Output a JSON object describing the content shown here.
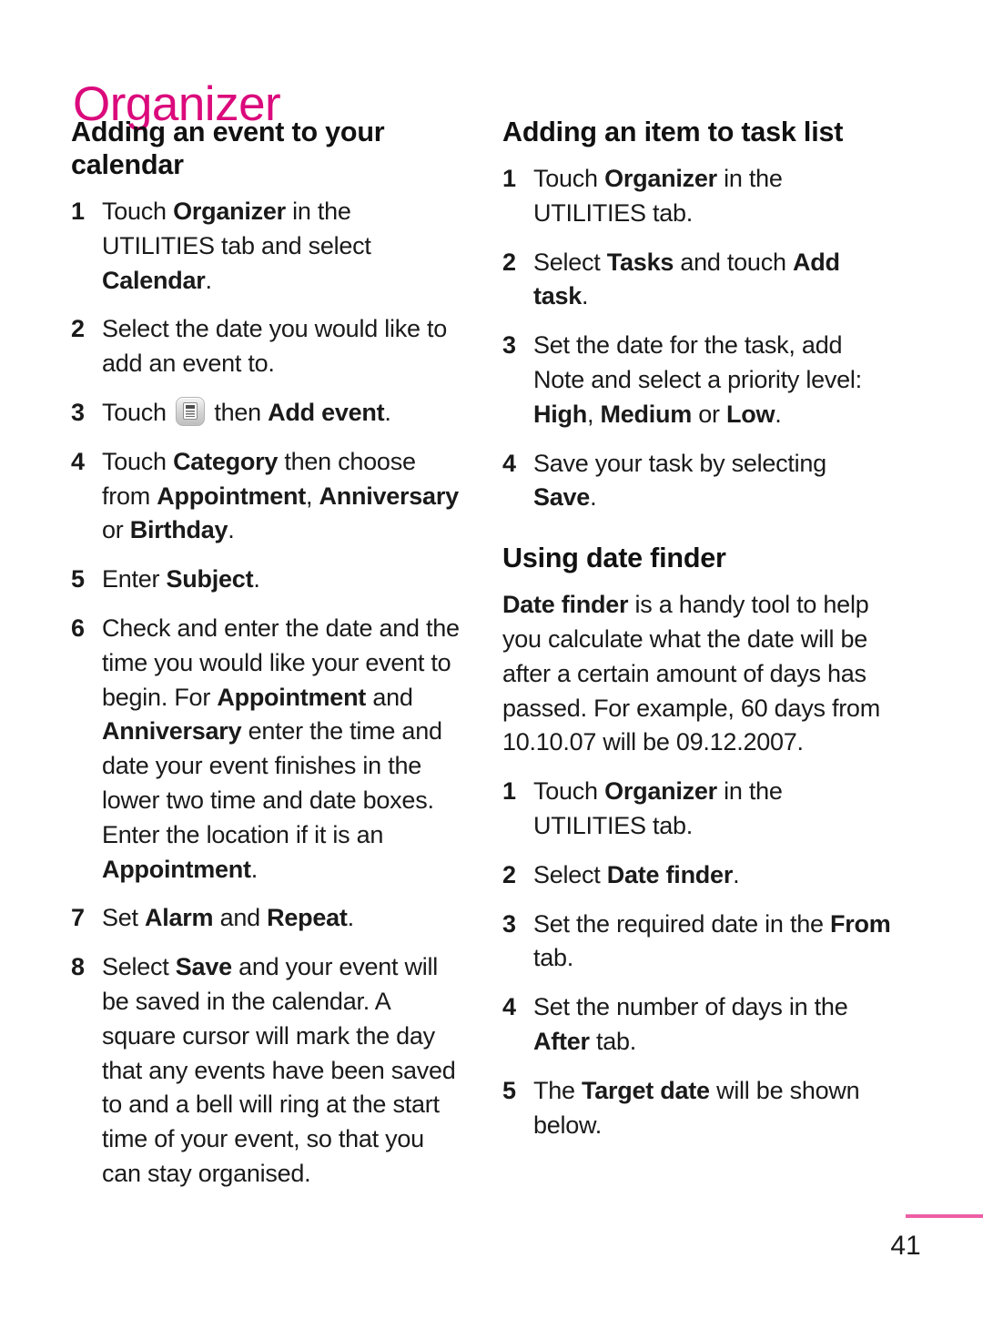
{
  "page": {
    "chapter_title": "Organizer",
    "page_number": "41",
    "accent_color": "#DB0A7C",
    "rule_color": "#ED5FA5",
    "text_color": "#1a1a1a"
  },
  "left_column": {
    "section": {
      "heading": "Adding an event to your calendar",
      "steps": [
        {
          "num": "1",
          "parts": [
            {
              "text": "Touch ",
              "bold": false
            },
            {
              "text": "Organizer",
              "bold": true
            },
            {
              "text": " in the UTILITIES tab and select ",
              "bold": false
            },
            {
              "text": "Calendar",
              "bold": true
            },
            {
              "text": ".",
              "bold": false
            }
          ]
        },
        {
          "num": "2",
          "parts": [
            {
              "text": "Select the date you would like to add an event to.",
              "bold": false
            }
          ]
        },
        {
          "num": "3",
          "icon": "menu-options-icon",
          "parts": [
            {
              "text": "Touch ",
              "bold": false
            },
            {
              "icon": "menu-options-icon"
            },
            {
              "text": " then ",
              "bold": false
            },
            {
              "text": "Add event",
              "bold": true
            },
            {
              "text": ".",
              "bold": false
            }
          ]
        },
        {
          "num": "4",
          "parts": [
            {
              "text": "Touch ",
              "bold": false
            },
            {
              "text": "Category",
              "bold": true
            },
            {
              "text": " then choose from ",
              "bold": false
            },
            {
              "text": "Appointment",
              "bold": true
            },
            {
              "text": ", ",
              "bold": false
            },
            {
              "text": "Anniversary",
              "bold": true
            },
            {
              "text": " or ",
              "bold": false
            },
            {
              "text": "Birthday",
              "bold": true
            },
            {
              "text": ".",
              "bold": false
            }
          ]
        },
        {
          "num": "5",
          "parts": [
            {
              "text": "Enter ",
              "bold": false
            },
            {
              "text": "Subject",
              "bold": true
            },
            {
              "text": ".",
              "bold": false
            }
          ]
        },
        {
          "num": "6",
          "parts": [
            {
              "text": "Check and enter the date and the time you would like your event to begin. For ",
              "bold": false
            },
            {
              "text": "Appointment",
              "bold": true
            },
            {
              "text": " and ",
              "bold": false
            },
            {
              "text": "Anniversary",
              "bold": true
            },
            {
              "text": " enter the time and date your event finishes in the lower two time and date boxes. Enter the location if it is an ",
              "bold": false
            },
            {
              "text": "Appointment",
              "bold": true
            },
            {
              "text": ".",
              "bold": false
            }
          ]
        },
        {
          "num": "7",
          "parts": [
            {
              "text": "Set ",
              "bold": false
            },
            {
              "text": "Alarm",
              "bold": true
            },
            {
              "text": " and ",
              "bold": false
            },
            {
              "text": "Repeat",
              "bold": true
            },
            {
              "text": ".",
              "bold": false
            }
          ]
        },
        {
          "num": "8",
          "parts": [
            {
              "text": "Select ",
              "bold": false
            },
            {
              "text": "Save",
              "bold": true
            },
            {
              "text": " and your event will be saved in the calendar. A square cursor will mark the day that any events have been saved to and a bell will ring at the start time of your event, so that you can stay organised.",
              "bold": false
            }
          ]
        }
      ]
    }
  },
  "right_column": {
    "sections": [
      {
        "heading": "Adding an item to task list",
        "body": null,
        "steps": [
          {
            "num": "1",
            "parts": [
              {
                "text": "Touch ",
                "bold": false
              },
              {
                "text": "Organizer",
                "bold": true
              },
              {
                "text": " in the UTILITIES tab.",
                "bold": false
              }
            ]
          },
          {
            "num": "2",
            "parts": [
              {
                "text": "Select ",
                "bold": false
              },
              {
                "text": "Tasks",
                "bold": true
              },
              {
                "text": " and touch ",
                "bold": false
              },
              {
                "text": "Add task",
                "bold": true
              },
              {
                "text": ".",
                "bold": false
              }
            ]
          },
          {
            "num": "3",
            "parts": [
              {
                "text": "Set the date for the task, add Note and select a priority level: ",
                "bold": false
              },
              {
                "text": "High",
                "bold": true
              },
              {
                "text": ", ",
                "bold": false
              },
              {
                "text": "Medium",
                "bold": true
              },
              {
                "text": " or ",
                "bold": false
              },
              {
                "text": "Low",
                "bold": true
              },
              {
                "text": ".",
                "bold": false
              }
            ]
          },
          {
            "num": "4",
            "parts": [
              {
                "text": "Save your task by selecting ",
                "bold": false
              },
              {
                "text": "Save",
                "bold": true
              },
              {
                "text": ".",
                "bold": false
              }
            ]
          }
        ]
      },
      {
        "heading": "Using date finder",
        "body": [
          {
            "text": "Date finder",
            "bold": true
          },
          {
            "text": " is a handy tool to help you calculate what the date will be after a certain amount of days has passed. For example, 60 days from 10.10.07 will be 09.12.2007.",
            "bold": false
          }
        ],
        "steps": [
          {
            "num": "1",
            "parts": [
              {
                "text": "Touch ",
                "bold": false
              },
              {
                "text": "Organizer",
                "bold": true
              },
              {
                "text": " in the UTILITIES tab.",
                "bold": false
              }
            ]
          },
          {
            "num": "2",
            "parts": [
              {
                "text": "Select ",
                "bold": false
              },
              {
                "text": "Date finder",
                "bold": true
              },
              {
                "text": ".",
                "bold": false
              }
            ]
          },
          {
            "num": "3",
            "parts": [
              {
                "text": "Set the required date in the ",
                "bold": false
              },
              {
                "text": "From",
                "bold": true
              },
              {
                "text": " tab.",
                "bold": false
              }
            ]
          },
          {
            "num": "4",
            "parts": [
              {
                "text": "Set the number of days in the ",
                "bold": false
              },
              {
                "text": "After",
                "bold": true
              },
              {
                "text": " tab.",
                "bold": false
              }
            ]
          },
          {
            "num": "5",
            "parts": [
              {
                "text": "The ",
                "bold": false
              },
              {
                "text": "Target date",
                "bold": true
              },
              {
                "text": " will be shown below.",
                "bold": false
              }
            ]
          }
        ]
      }
    ]
  }
}
